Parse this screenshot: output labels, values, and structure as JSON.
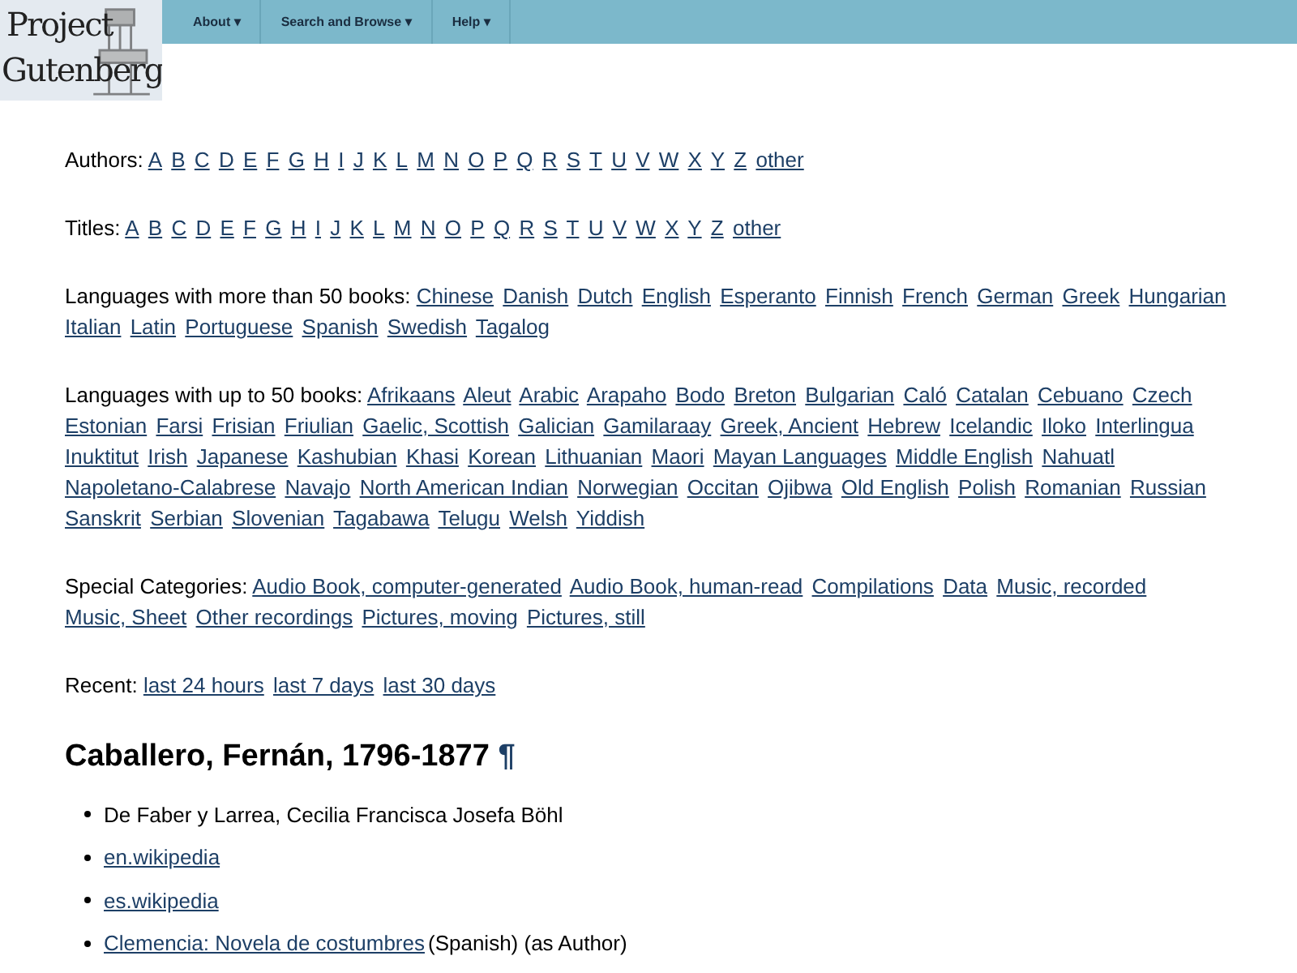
{
  "logo": {
    "lines": [
      "Project",
      "Gutenberg"
    ]
  },
  "nav": [
    "About ▾",
    "Search and Browse ▾",
    "Help ▾"
  ],
  "sections": [
    {
      "label": "Authors:",
      "links": [
        "A",
        "B",
        "C",
        "D",
        "E",
        "F",
        "G",
        "H",
        "I",
        "J",
        "K",
        "L",
        "M",
        "N",
        "O",
        "P",
        "Q",
        "R",
        "S",
        "T",
        "U",
        "V",
        "W",
        "X",
        "Y",
        "Z",
        "other"
      ]
    },
    {
      "label": "Titles:",
      "links": [
        "A",
        "B",
        "C",
        "D",
        "E",
        "F",
        "G",
        "H",
        "I",
        "J",
        "K",
        "L",
        "M",
        "N",
        "O",
        "P",
        "Q",
        "R",
        "S",
        "T",
        "U",
        "V",
        "W",
        "X",
        "Y",
        "Z",
        "other"
      ]
    },
    {
      "label": "Languages with more than 50 books:",
      "links": [
        "Chinese",
        "Danish",
        "Dutch",
        "English",
        "Esperanto",
        "Finnish",
        "French",
        "German",
        "Greek",
        "Hungarian",
        "Italian",
        "Latin",
        "Portuguese",
        "Spanish",
        "Swedish",
        "Tagalog"
      ]
    },
    {
      "label": "Languages with up to 50 books:",
      "links": [
        "Afrikaans",
        "Aleut",
        "Arabic",
        "Arapaho",
        "Bodo",
        "Breton",
        "Bulgarian",
        "Caló",
        "Catalan",
        "Cebuano",
        "Czech",
        "Estonian",
        "Farsi",
        "Frisian",
        "Friulian",
        "Gaelic, Scottish",
        "Galician",
        "Gamilaraay",
        "Greek, Ancient",
        "Hebrew",
        "Icelandic",
        "Iloko",
        "Interlingua",
        "Inuktitut",
        "Irish",
        "Japanese",
        "Kashubian",
        "Khasi",
        "Korean",
        "Lithuanian",
        "Maori",
        "Mayan Languages",
        "Middle English",
        "Nahuatl",
        "Napoletano-Calabrese",
        "Navajo",
        "North American Indian",
        "Norwegian",
        "Occitan",
        "Ojibwa",
        "Old English",
        "Polish",
        "Romanian",
        "Russian",
        "Sanskrit",
        "Serbian",
        "Slovenian",
        "Tagabawa",
        "Telugu",
        "Welsh",
        "Yiddish"
      ]
    },
    {
      "label": "Special Categories:",
      "links": [
        "Audio Book, computer-generated",
        "Audio Book, human-read",
        "Compilations",
        "Data",
        "Music, recorded",
        "Music, Sheet",
        "Other recordings",
        "Pictures, moving",
        "Pictures, still"
      ]
    },
    {
      "label": "Recent:",
      "links": [
        "last 24 hours",
        "last 7 days",
        "last 30 days"
      ]
    }
  ],
  "author": {
    "heading": "Caballero, Fernán, 1796-1877",
    "anchor": "¶"
  },
  "items": [
    {
      "kind": "text",
      "text": "De Faber y Larrea, Cecilia Francisca Josefa Böhl"
    },
    {
      "kind": "link",
      "text": "en.wikipedia"
    },
    {
      "kind": "link",
      "text": "es.wikipedia"
    },
    {
      "kind": "book",
      "text": "Clemencia: Novela de costumbres",
      "note": "(Spanish) (as Author)"
    }
  ]
}
